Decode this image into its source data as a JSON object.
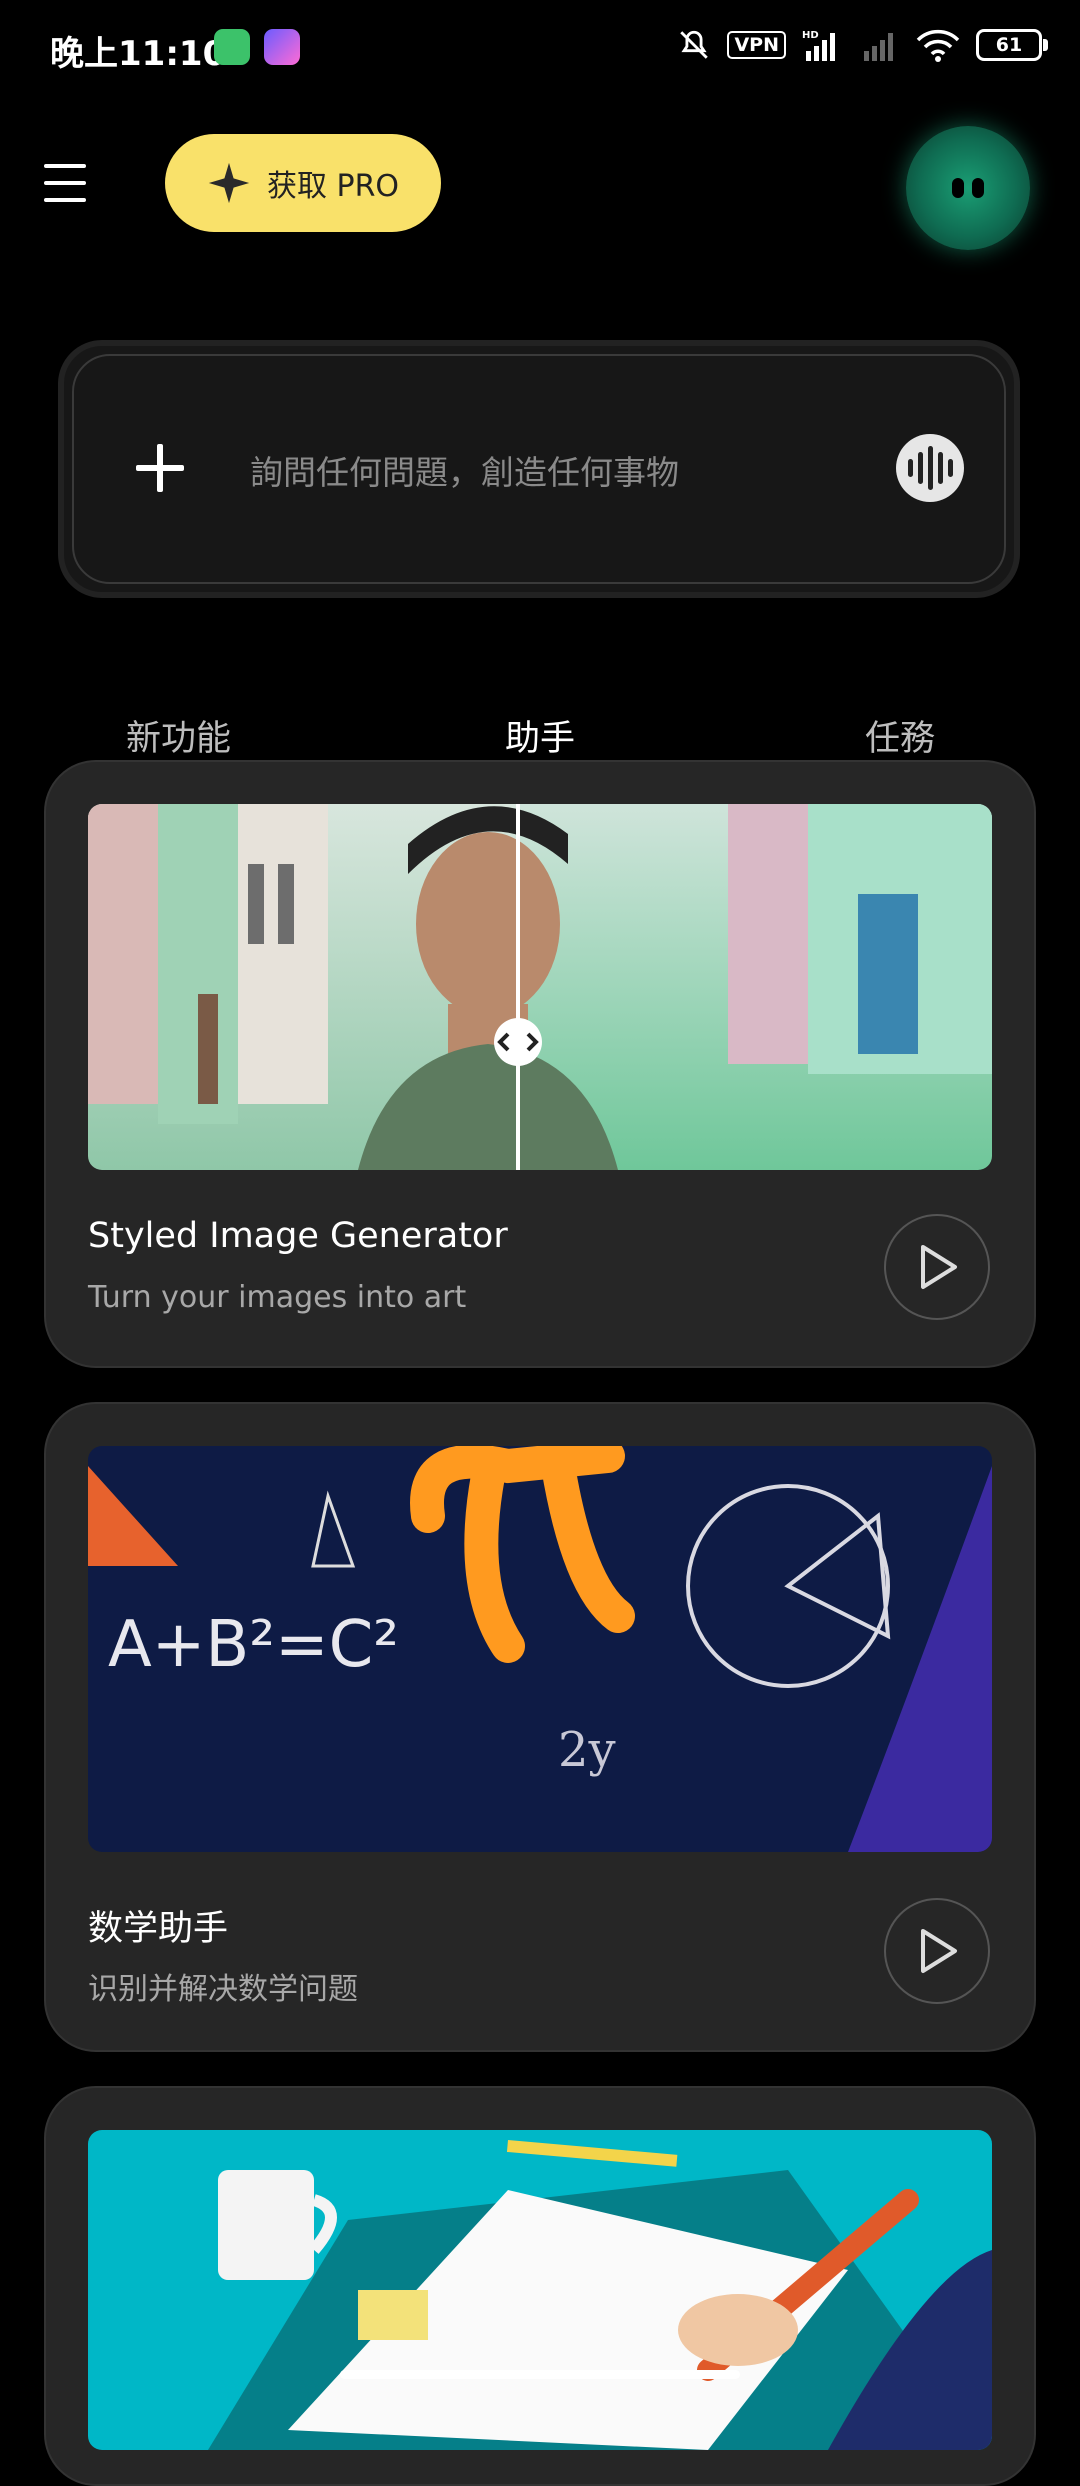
{
  "status": {
    "time": "晚上11:10",
    "vpn": "VPN",
    "hd": "HD",
    "battery": "61"
  },
  "header": {
    "pro_label": "获取 PRO"
  },
  "ask": {
    "placeholder": "詢問任何問題，創造任何事物"
  },
  "tabs": [
    {
      "label": "新功能"
    },
    {
      "label": "助手"
    },
    {
      "label": "任務"
    }
  ],
  "cards": [
    {
      "title": "Styled Image Generator",
      "subtitle": "Turn your images into art"
    },
    {
      "title": "数学助手",
      "subtitle": "识别并解决数学问题"
    }
  ],
  "math_image_text": {
    "formula": "A+B²=C²",
    "var": "2y"
  },
  "colors": {
    "pro_bg": "#f9e16a",
    "card_bg": "#262626",
    "accent_teal": "#00b7c7"
  },
  "icons": [
    "menu-icon",
    "sparkle-icon",
    "plus-icon",
    "voice-icon",
    "compare-handle-icon",
    "play-icon"
  ]
}
